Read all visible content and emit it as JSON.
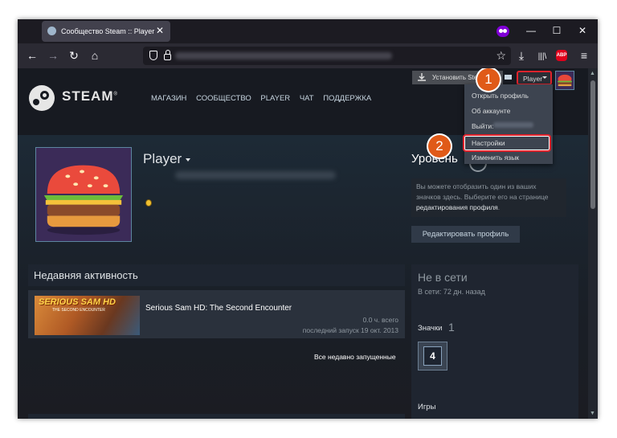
{
  "browser": {
    "tab_title": "Сообщество Steam :: Player",
    "tab_close": "✕",
    "win_min": "—",
    "win_max": "☐",
    "win_close": "✕",
    "back": "←",
    "forward": "→",
    "reload": "↻",
    "home": "⌂",
    "bookmark": "☆",
    "downloads": "⤓",
    "library": "|||\\",
    "abp": "ABP",
    "menu": "≡"
  },
  "header": {
    "logo_text": "STEAM",
    "logo_tm": "®",
    "nav": [
      "МАГАЗИН",
      "СООБЩЕСТВО",
      "PLAYER",
      "ЧАТ",
      "ПОДДЕРЖКА"
    ],
    "install_label": "Установить Steam",
    "account_label": "Player"
  },
  "dropdown": {
    "items": [
      "Открыть профиль",
      "Об аккаунте",
      "Выйти:",
      "Настройки",
      "Изменить язык"
    ]
  },
  "annotations": {
    "step1": "1",
    "step2": "2"
  },
  "profile": {
    "username": "Player",
    "level_title": "Уровень",
    "showcase_text": "Вы можете отобразить один из ваших значков здесь. Выберите его на странице",
    "showcase_link": "редактирования профиля",
    "showcase_end": ".",
    "edit_button": "Редактировать профиль"
  },
  "activity": {
    "header": "Недавняя активность",
    "games": [
      {
        "title": "Serious Sam HD: The Second Encounter",
        "capsule_title": "SERIOUS SAM HD",
        "capsule_sub": "THE SECOND ENCOUNTER",
        "hours": "0.0 ч. всего",
        "last_played": "последний запуск 19 окт. 2013"
      }
    ],
    "all_recent": "Все недавно запущенные"
  },
  "sidebar": {
    "status": "Не в сети",
    "last_online": "В сети: 72 дн. назад",
    "badges_label": "Значки",
    "badges_count": "1",
    "badge_level": "4",
    "games_label": "Игры"
  },
  "colors": {
    "accent_red": "#e0232c",
    "step_orange": "#e05a18",
    "steam_bg": "#171a21"
  }
}
